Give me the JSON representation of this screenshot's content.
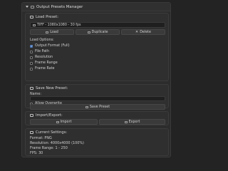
{
  "app": {
    "title": "Output Presets Manager"
  },
  "load_preset": {
    "title": "Load Preset:",
    "selected": "TIFF - 1080x1080 - 30 fps",
    "buttons": {
      "load": "Load",
      "duplicate": "Duplicate",
      "delete": "Delete"
    },
    "load_options_label": "Load Options:",
    "options": [
      {
        "label": "Output Format (Full)",
        "checked": true
      },
      {
        "label": "File Path",
        "checked": false
      },
      {
        "label": "Resolution",
        "checked": false
      },
      {
        "label": "Frame Range",
        "checked": false
      },
      {
        "label": "Frame Rate",
        "checked": false
      }
    ]
  },
  "save_preset": {
    "title": "Save New Preset:",
    "name_label": "Name:",
    "allow_overwrite_label": "Allow Overwrite",
    "save_button": "Save Preset"
  },
  "import_export": {
    "title": "Import/Export:",
    "import": "Import",
    "export": "Export"
  },
  "current_settings": {
    "title": "Current Settings:",
    "format": "Format: PNG",
    "resolution": "Resolution: 4000x4000 (100%)",
    "frame_range": "Frame Range: 1 - 250",
    "fps": "FPS: 30"
  },
  "icons": {
    "panel_header": "panel-icon",
    "load": "folder-icon",
    "duplicate": "duplicate-icon",
    "delete": "close-icon",
    "save": "save-icon",
    "import": "import-icon",
    "export": "export-icon",
    "info": "info-icon"
  },
  "colors": {
    "background": "#232323",
    "panel": "#2c2c2c",
    "section": "#2f2f2f",
    "button": "#3a3a3a",
    "accent_checkbox": "#4a76b5"
  }
}
